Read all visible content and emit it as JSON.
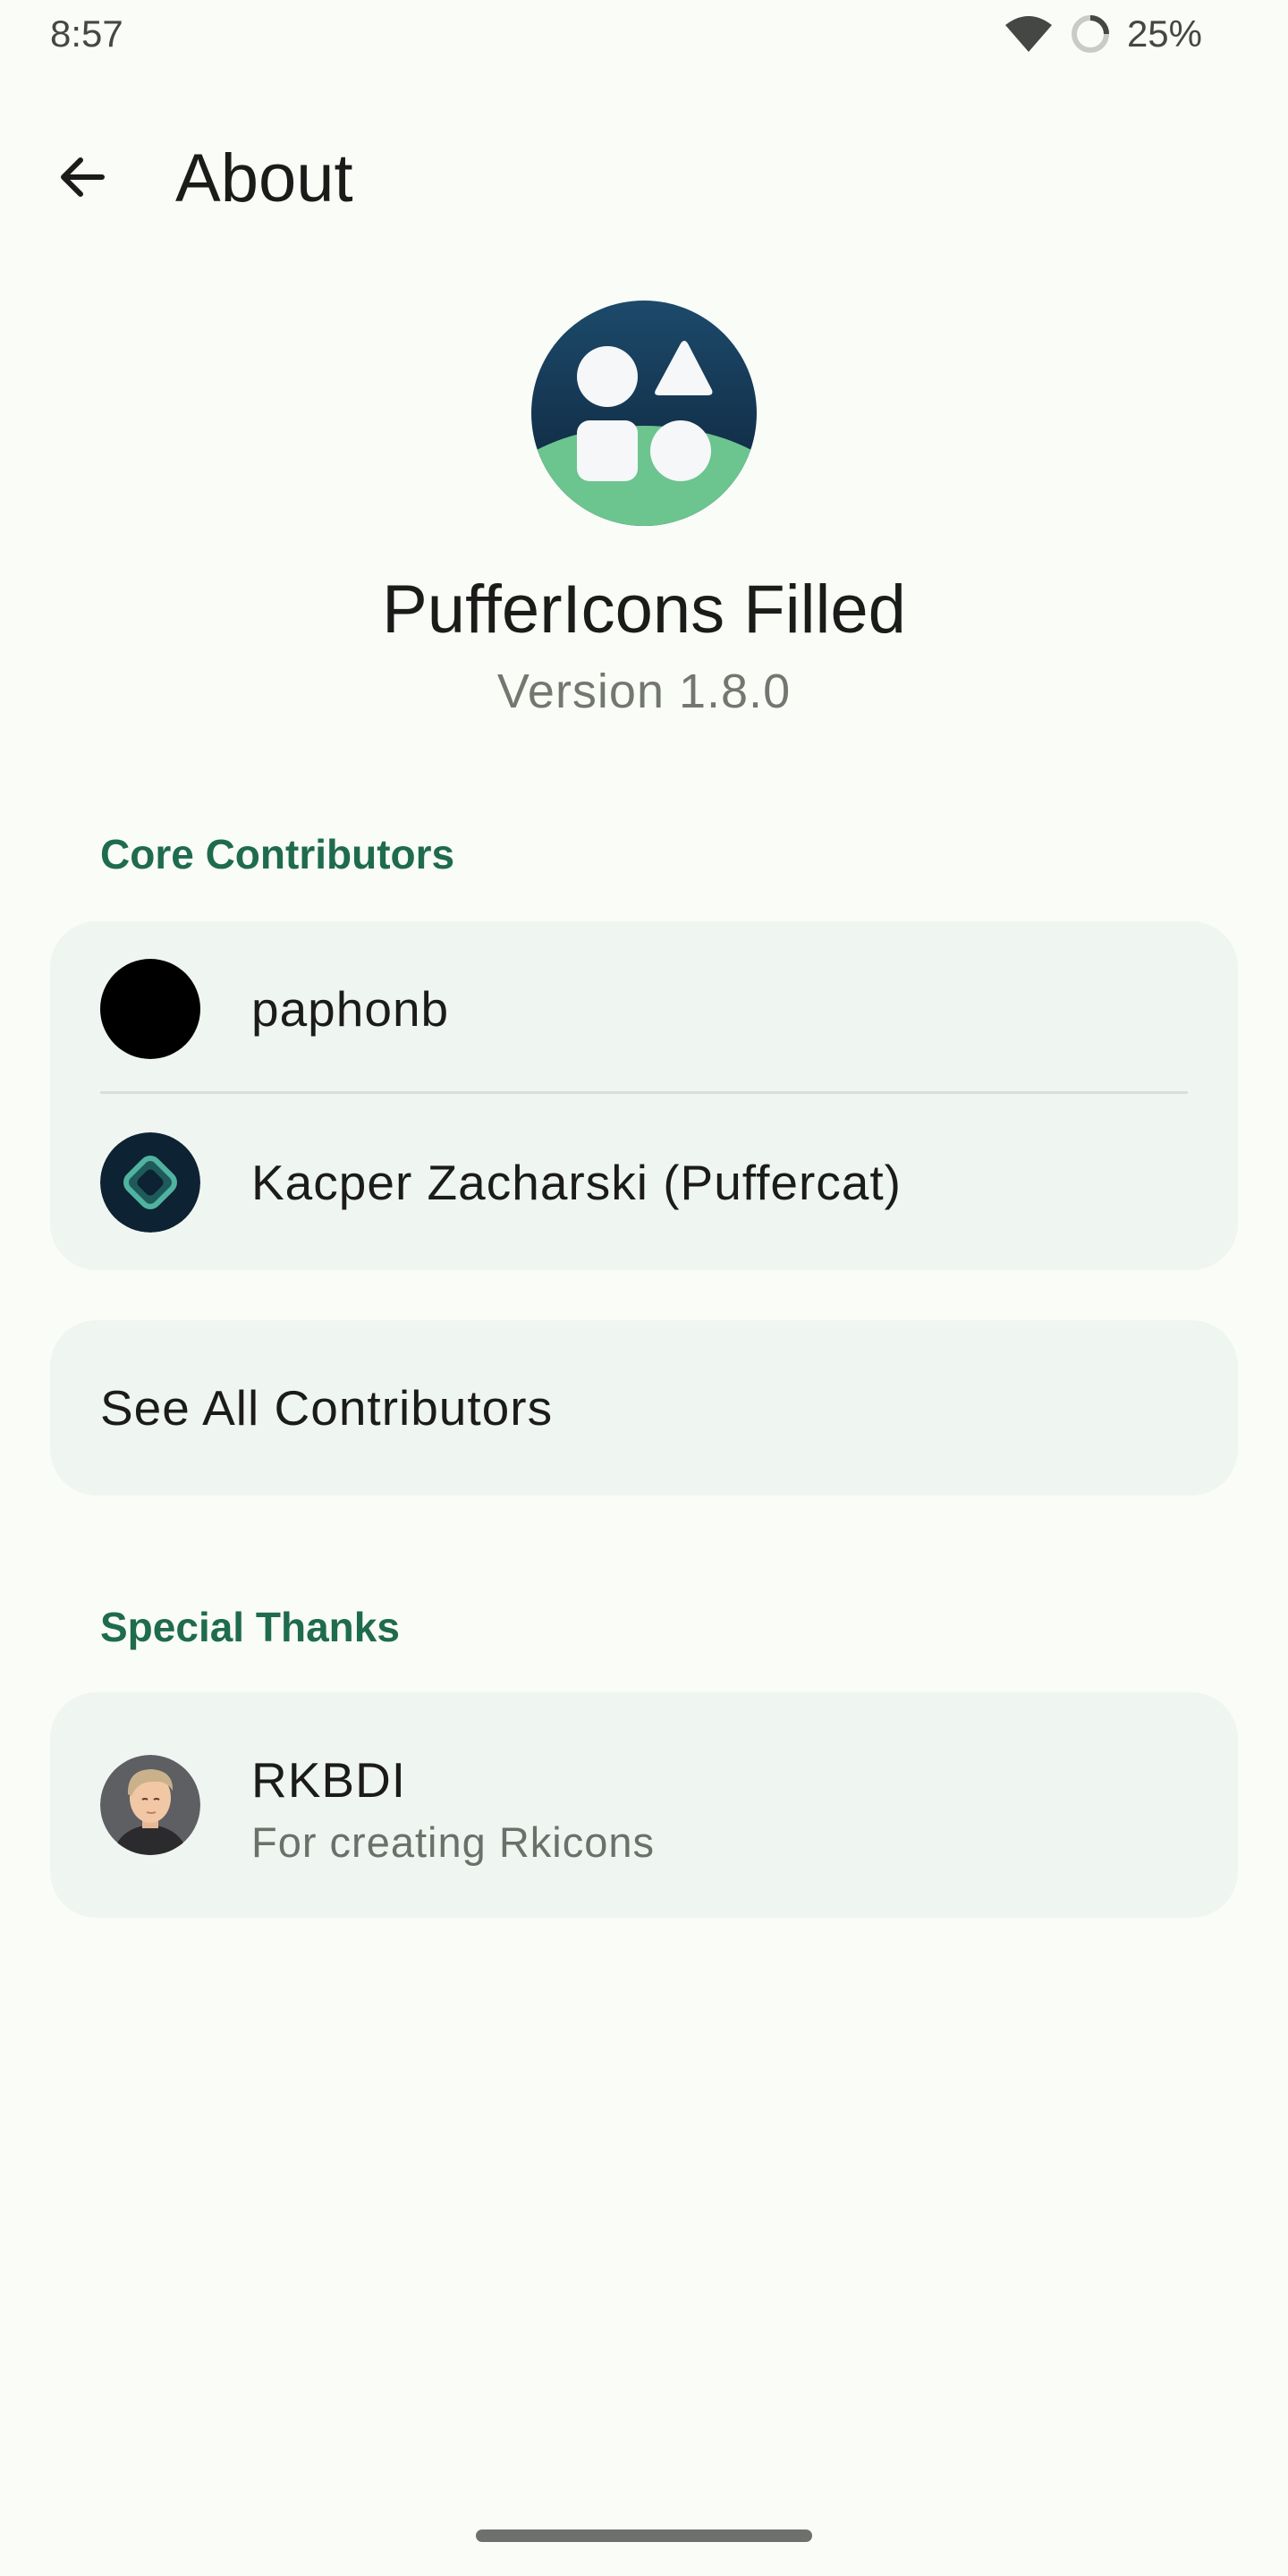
{
  "status_bar": {
    "time": "8:57",
    "battery": "25%",
    "icons": [
      "wifi-icon",
      "battery-ring-icon"
    ]
  },
  "top_bar": {
    "title": "About",
    "back_icon": "arrow-back-icon"
  },
  "app": {
    "name": "PufferIcons Filled",
    "version": "Version 1.8.0"
  },
  "sections": {
    "core": {
      "header": "Core Contributors",
      "contributors": [
        {
          "name": "paphonb",
          "avatar": "black-circle-avatar"
        },
        {
          "name": "Kacper Zacharski (Puffercat)",
          "avatar": "diamond-logo-avatar"
        }
      ]
    },
    "see_all": {
      "label": "See All Contributors"
    },
    "thanks": {
      "header": "Special Thanks",
      "people": [
        {
          "name": "RKBDI",
          "note": "For creating Rkicons",
          "avatar": "illustrated-person-avatar"
        }
      ]
    }
  },
  "colors": {
    "background": "#fafcf8",
    "card": "#eff5f0",
    "accent": "#1f6b4f",
    "logo_dark": "#15304a",
    "logo_green": "#6cc48f"
  }
}
